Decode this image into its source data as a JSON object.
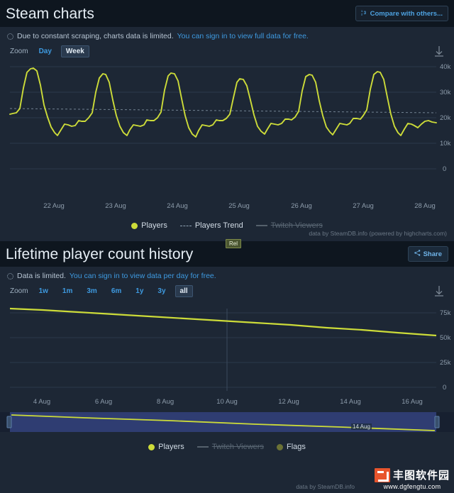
{
  "chart1": {
    "title": "Steam charts",
    "compare_button": "Compare with others...",
    "notice_text": "Due to constant scraping, charts data is limited.",
    "notice_link": "You can sign in to view full data for free.",
    "zoom_label": "Zoom",
    "ranges": [
      {
        "label": "Day",
        "selected": false
      },
      {
        "label": "Week",
        "selected": true
      }
    ],
    "legend": [
      {
        "label": "Players",
        "marker": "dot",
        "color": "#cddc39",
        "disabled": false
      },
      {
        "label": "Players Trend",
        "marker": "dash",
        "color": "#8fa1b2",
        "disabled": false
      },
      {
        "label": "Twitch Viewers",
        "marker": "line",
        "color": "#55606c",
        "disabled": true
      }
    ],
    "credit": "data by SteamDB.info (powered by highcharts.com)"
  },
  "chart2": {
    "title": "Lifetime player count history",
    "share_button": "Share",
    "notice_text": "Data is limited.",
    "notice_link": "You can sign in to view data per day for free.",
    "zoom_label": "Zoom",
    "ranges": [
      {
        "label": "1w",
        "selected": false
      },
      {
        "label": "1m",
        "selected": false
      },
      {
        "label": "3m",
        "selected": false
      },
      {
        "label": "6m",
        "selected": false
      },
      {
        "label": "1y",
        "selected": false
      },
      {
        "label": "3y",
        "selected": false
      },
      {
        "label": "all",
        "selected": true
      }
    ],
    "flag_label": "Rel",
    "navigator_label": "14 Aug",
    "legend": [
      {
        "label": "Players",
        "marker": "dot",
        "color": "#cddc39",
        "disabled": false
      },
      {
        "label": "Twitch Viewers",
        "marker": "line",
        "color": "#55606c",
        "disabled": true
      },
      {
        "label": "Flags",
        "marker": "dot",
        "color": "#6b7235",
        "disabled": false
      }
    ],
    "credit": "data by SteamDB.info"
  },
  "watermark": {
    "cn": "丰图软件园",
    "url": "www.dgfengtu.com"
  },
  "chart_data": [
    {
      "type": "line",
      "title": "Steam charts",
      "xlabel": "",
      "ylabel": "",
      "grid": true,
      "legend_position": "bottom",
      "xlim": [
        "21 Aug",
        "28 Aug"
      ],
      "ylim": [
        0,
        45000
      ],
      "yticks": [
        0,
        10000,
        20000,
        30000,
        40000
      ],
      "ytick_labels": [
        "0",
        "10k",
        "20k",
        "30k",
        "40k"
      ],
      "xticks": [
        "22 Aug",
        "23 Aug",
        "24 Aug",
        "25 Aug",
        "26 Aug",
        "27 Aug",
        "28 Aug"
      ],
      "series": [
        {
          "name": "Players",
          "color": "#cddc39",
          "values": [
            21500,
            21800,
            22200,
            24000,
            31000,
            39500,
            42500,
            42800,
            41500,
            35000,
            27000,
            22000,
            18500,
            16500,
            15500,
            17500,
            19500,
            19200,
            18700,
            19000,
            20500,
            20300,
            20200,
            21500,
            23000,
            30000,
            37500,
            39500,
            39000,
            36000,
            29000,
            23000,
            19000,
            16800,
            15800,
            17500,
            19200,
            19000,
            18800,
            19200,
            20800,
            20600,
            20400,
            21800,
            23500,
            31000,
            38500,
            40000,
            39500,
            36500,
            29500,
            23000,
            18500,
            16000,
            15000,
            17000,
            19000,
            18800,
            18600,
            19000,
            20500,
            20400,
            20200,
            21000,
            22500,
            28000,
            34500,
            36000,
            35500,
            33000,
            27500,
            22500,
            18800,
            17000,
            16000,
            17800,
            19500,
            19300,
            19100,
            19500,
            20800,
            20700,
            20600,
            21500,
            23200,
            30500,
            38000,
            39200,
            38800,
            35500,
            28500,
            22500,
            18500,
            16500,
            15500,
            17500,
            19300,
            19100,
            18900,
            19300,
            21000,
            20900,
            20800,
            22000,
            24000,
            31500,
            39000,
            40500,
            40000,
            37000,
            30000,
            23500,
            19000,
            16800,
            15800,
            17800,
            19500,
            19300,
            19000,
            18500,
            19500,
            20500,
            20800,
            20200
          ]
        },
        {
          "name": "Players Trend",
          "color": "#8fa1b2",
          "style": "dashed",
          "values": [
            23800,
            23500,
            23200,
            22900,
            22600,
            22300,
            22100,
            22400
          ]
        },
        {
          "name": "Twitch Viewers",
          "color": "#55606c",
          "disabled": true,
          "values": []
        }
      ]
    },
    {
      "type": "line",
      "title": "Lifetime player count history",
      "xlabel": "",
      "ylabel": "",
      "grid": true,
      "legend_position": "bottom",
      "xlim": [
        "3 Aug",
        "17 Aug"
      ],
      "ylim": [
        0,
        85000
      ],
      "yticks": [
        0,
        25000,
        50000,
        75000
      ],
      "ytick_labels": [
        "0",
        "25k",
        "50k",
        "75k"
      ],
      "xticks": [
        "4 Aug",
        "6 Aug",
        "8 Aug",
        "10 Aug",
        "12 Aug",
        "14 Aug",
        "16 Aug"
      ],
      "annotations": [
        {
          "label": "Rel",
          "x": "10 Aug"
        }
      ],
      "series": [
        {
          "name": "Players",
          "color": "#cddc39",
          "values": [
            76000,
            74500,
            73000,
            71500,
            70000,
            68500,
            67000,
            65500,
            64000,
            62500,
            61000,
            59500,
            58000,
            56500,
            55000
          ]
        },
        {
          "name": "Twitch Viewers",
          "color": "#55606c",
          "disabled": true,
          "values": []
        },
        {
          "name": "Flags",
          "color": "#6b7235",
          "values": []
        }
      ]
    }
  ]
}
